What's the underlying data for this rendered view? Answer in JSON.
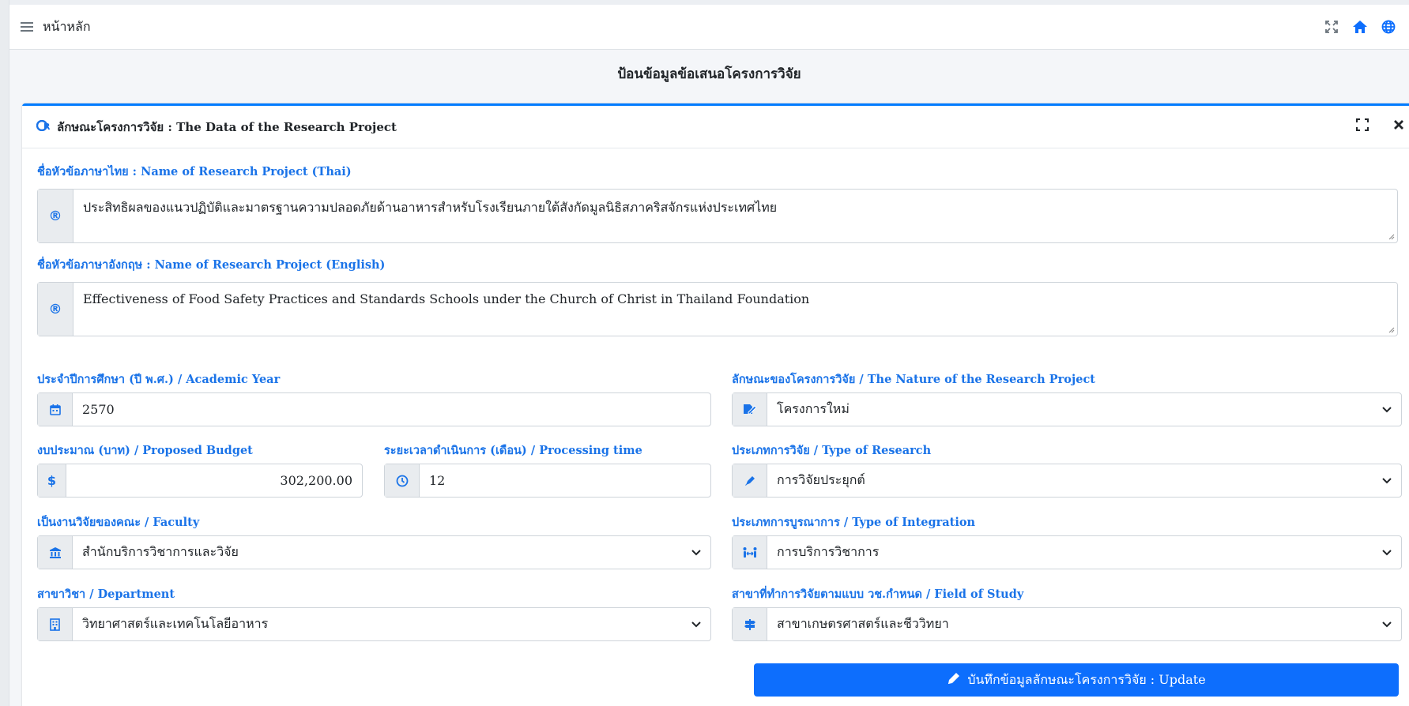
{
  "navbar": {
    "home_label": "หน้าหลัก",
    "icons": [
      "menu-icon",
      "expand-icon",
      "home-icon",
      "globe-icon"
    ]
  },
  "page": {
    "title": "ป้อนข้อมูลข้อเสนอโครงการวิจัย"
  },
  "card": {
    "title": "ลักษณะโครงการวิจัย : The Data of the Research Project",
    "accent": "#007bff"
  },
  "form": {
    "name_thai": {
      "label": "ชื่อหัวข้อภาษาไทย : Name of Research Project (Thai)",
      "value": "ประสิทธิผลของแนวปฏิบัติและมาตรฐานความปลอดภัยด้านอาหารสำหรับโรงเรียนภายใต้สังกัดมูลนิธิสภาคริสจักรแห่งประเทศไทย"
    },
    "name_english": {
      "label": "ชื่อหัวข้อภาษาอังกฤษ : Name of Research Project (English)",
      "value": "Effectiveness of Food Safety Practices and Standards Schools under the Church of Christ in Thailand Foundation"
    },
    "academic_year": {
      "label": "ประจำปีการศึกษา (ปี พ.ศ.) / Academic Year",
      "value": "2570"
    },
    "nature": {
      "label": "ลักษณะของโครงการวิจัย / The Nature of the Research Project",
      "value": "โครงการใหม่"
    },
    "budget": {
      "label": "งบประมาณ (บาท) / Proposed Budget",
      "value": "302,200.00"
    },
    "processing_time": {
      "label": "ระยะเวลาดำเนินการ (เดือน) / Processing time",
      "value": "12"
    },
    "research_type": {
      "label": "ประเภทการวิจัย / Type of Research",
      "value": "การวิจัยประยุกต์"
    },
    "faculty": {
      "label": "เป็นงานวิจัยของคณะ / Faculty",
      "value": "สำนักบริการวิชาการและวิจัย"
    },
    "integration": {
      "label": "ประเภทการบูรณาการ / Type of Integration",
      "value": "การบริการวิชาการ"
    },
    "department": {
      "label": "สาขาวิชา / Department",
      "value": "วิทยาศาสตร์และเทคโนโลยีอาหาร"
    },
    "field_of_study": {
      "label": "สาขาที่ทำการวิจัยตามแบบ วช.กำหนด / Field of Study",
      "value": "สาขาเกษตรศาสตร์และชีววิทยา"
    },
    "update_button": "บันทึกข้อมูลลักษณะโครงการวิจัย : Update",
    "addon_symbol": "®",
    "currency_symbol": "$"
  }
}
